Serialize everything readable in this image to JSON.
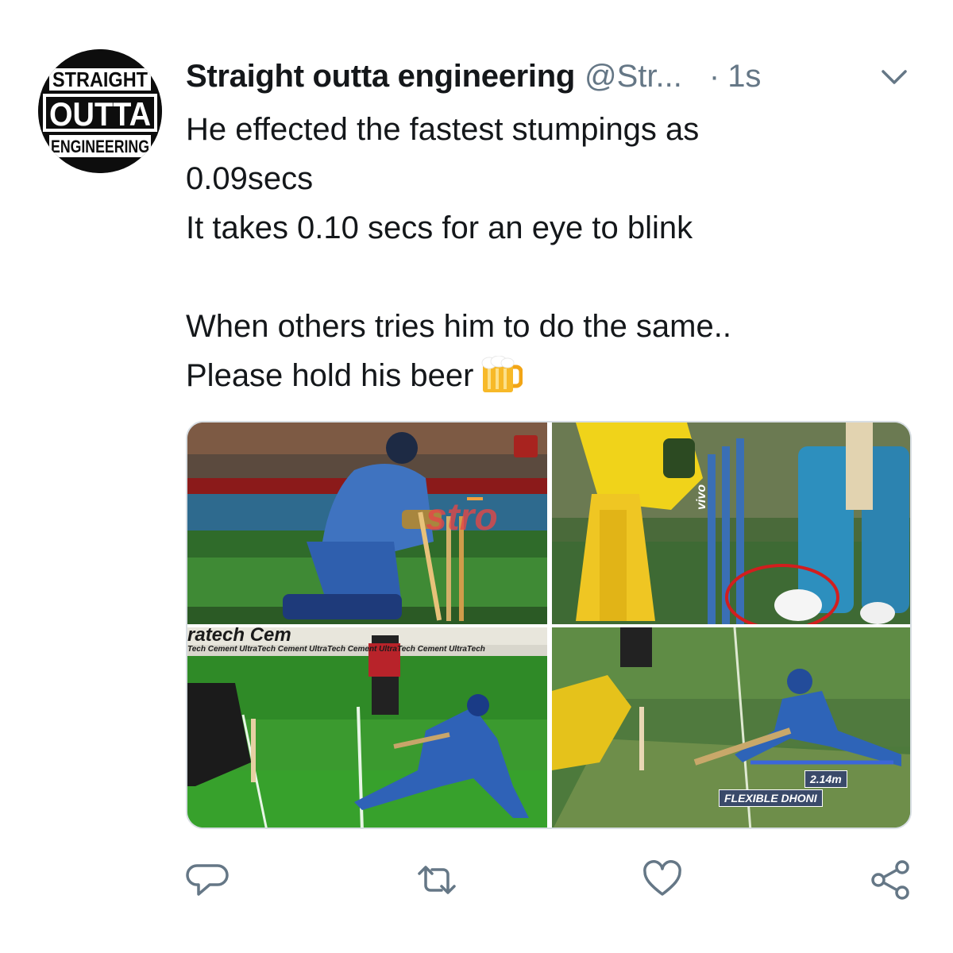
{
  "account": {
    "display_name": "Straight outta engineering",
    "handle": "@Str...",
    "separator": "·",
    "timestamp": "1s",
    "avatar_lines": [
      "STRAIGHT",
      "OUTTA",
      "ENGINEERING"
    ]
  },
  "tweet": {
    "lines": [
      "He effected the fastest stumpings as",
      "0.09secs",
      "It takes 0.10 secs for an eye to blink",
      "",
      "When others tries him to do the same..",
      "Please hold his beer"
    ],
    "emoji": "beer-mug-icon"
  },
  "media": {
    "images": [
      {
        "board_text": "stro"
      },
      {
        "board_text": "vivo"
      },
      {
        "board_text": "ratech Cem",
        "board_text_2": "Tech Cement UltraTech Cement UltraTech Cement UltraTech Cement UltraTech"
      },
      {
        "label_distance": "2.14m",
        "label_caption": "FLEXIBLE DHONI"
      }
    ]
  },
  "actions": {
    "reply_icon": "reply-icon",
    "retweet_icon": "retweet-icon",
    "like_icon": "heart-icon",
    "share_icon": "share-icon"
  },
  "colors": {
    "text": "#14171a",
    "secondary": "#657786",
    "icon": "#657786",
    "border": "#d8dee3"
  }
}
